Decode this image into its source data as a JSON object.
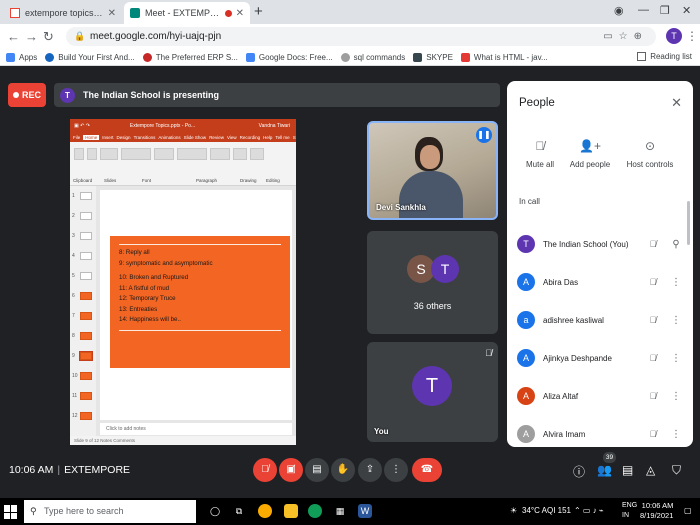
{
  "browser": {
    "tabs": [
      {
        "title": "extempore topics judgement she",
        "active": false
      },
      {
        "title": "Meet - EXTEMPORE",
        "active": true
      }
    ],
    "url": "meet.google.com/hyi-uajq-pjn",
    "profile_initial": "T",
    "bookmarks": [
      "Apps",
      "Build Your First And...",
      "The Preferred ERP S...",
      "Google Docs: Free...",
      "sql commands",
      "SKYPE",
      "What is HTML - jav..."
    ],
    "reading_list": "Reading list"
  },
  "meet": {
    "rec_label": "REC",
    "presenter_initial": "T",
    "presenting_text": "The Indian School is presenting",
    "time": "10:06 AM",
    "meeting_name": "EXTEMPORE",
    "people_count": "39"
  },
  "presentation": {
    "window_title": "Extempore Topics.pptx - Po...",
    "user": "Vandna Tiwari",
    "ribbon_tabs": [
      "File",
      "Home",
      "Insert",
      "Design",
      "Transitions",
      "Animations",
      "Slide Show",
      "Review",
      "View",
      "Recording",
      "Help",
      "Tell me",
      "Share"
    ],
    "ribbon_groups": [
      "Clipboard",
      "Slides",
      "Font",
      "Paragraph",
      "Drawing",
      "Editing"
    ],
    "slide_lines": [
      "8: Reply all",
      "9: symptomatic and asymptomatic",
      "10: Broken and Ruptured",
      "11: A fistful of mud",
      "12: Temporary Truce",
      "13: Entreaties",
      "14: Happiness will be.."
    ],
    "notes_placeholder": "Click to add notes",
    "status": "Slide 9 of 12   Notes   Comments"
  },
  "tiles": {
    "speaker_name": "Devi Sankhla",
    "others_initials": [
      "S",
      "T"
    ],
    "others_label": "36 others",
    "self_initial": "T",
    "self_label": "You"
  },
  "people_panel": {
    "title": "People",
    "actions": [
      "Mute all",
      "Add people",
      "Host controls"
    ],
    "section": "In call",
    "participants": [
      {
        "initial": "T",
        "name": "The Indian School (You)",
        "color": "#5e35b1"
      },
      {
        "initial": "A",
        "name": "Abira Das",
        "color": "#1a73e8"
      },
      {
        "initial": "a",
        "name": "adishree kasliwal",
        "color": "#1a73e8"
      },
      {
        "initial": "A",
        "name": "Ajinkya Deshpande",
        "color": "#1a73e8"
      },
      {
        "initial": "A",
        "name": "Aliza Altaf",
        "color": "#d84315"
      },
      {
        "initial": "A",
        "name": "Alvira Imam",
        "color": "#9e9e9e"
      }
    ]
  },
  "taskbar": {
    "search_placeholder": "Type here to search",
    "weather": "34°C  AQI 151",
    "lang": "ENG",
    "region": "IN",
    "time": "10:06 AM",
    "date": "8/19/2021"
  }
}
